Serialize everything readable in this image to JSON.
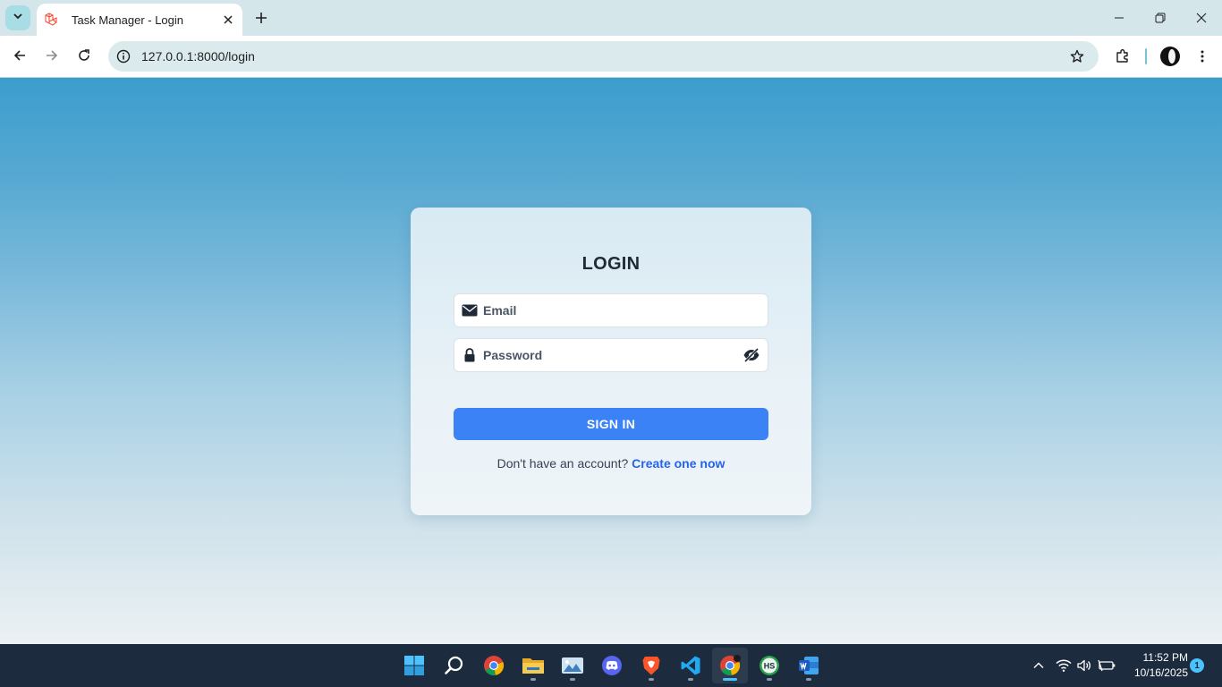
{
  "browser": {
    "tab": {
      "title": "Task Manager - Login",
      "favicon": "laravel-icon"
    },
    "address_bar": {
      "url": "127.0.0.1:8000/login"
    },
    "icons": [
      "tab-search-icon",
      "close-icon",
      "plus-icon",
      "minimize-icon",
      "restore-icon",
      "window-close-icon",
      "back-icon",
      "forward-icon",
      "reload-icon",
      "site-info-icon",
      "star-icon",
      "extensions-icon",
      "profile-avatar",
      "more-menu-icon"
    ]
  },
  "login": {
    "title": "LOGIN",
    "email_placeholder": "Email",
    "password_placeholder": "Password",
    "submit_label": "SIGN IN",
    "signup_prompt": "Don't have an account?",
    "signup_link": "Create one now"
  },
  "colors": {
    "primary_button": "#3b82f6",
    "link": "#2563eb",
    "gradient_top": "#3c9dcd",
    "gradient_bottom": "#ecf1f4",
    "taskbar": "#1c2b3d"
  },
  "taskbar": {
    "apps": [
      "windows-start-icon",
      "search-icon",
      "chrome-icon",
      "file-explorer-icon",
      "photos-icon",
      "discord-icon",
      "brave-icon",
      "vscode-icon",
      "chrome-active-icon",
      "hs-app-icon",
      "word-icon"
    ],
    "time": "11:52 PM",
    "date": "10/16/2025",
    "notifications": "1"
  }
}
